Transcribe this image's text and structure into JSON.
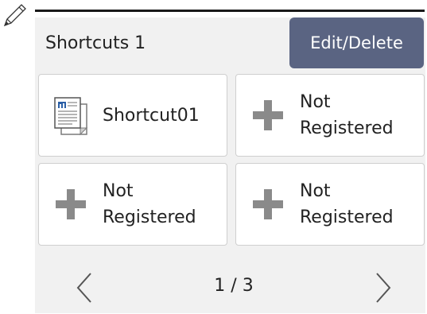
{
  "header": {
    "title": "Shortcuts 1",
    "edit_label": "Edit/Delete"
  },
  "tiles": [
    {
      "label": "Shortcut01",
      "icon": "copy-document-icon",
      "registered": true
    },
    {
      "label": "Not\nRegistered",
      "icon": "plus-icon",
      "registered": false
    },
    {
      "label": "Not\nRegistered",
      "icon": "plus-icon",
      "registered": false
    },
    {
      "label": "Not\nRegistered",
      "icon": "plus-icon",
      "registered": false
    }
  ],
  "pager": {
    "indicator": "1 / 3",
    "prev_icon": "chevron-left-icon",
    "next_icon": "chevron-right-icon"
  },
  "colors": {
    "edit_button": "#5a6482",
    "screen_bg": "#f1f1f1",
    "plus": "#8a8a8a"
  }
}
